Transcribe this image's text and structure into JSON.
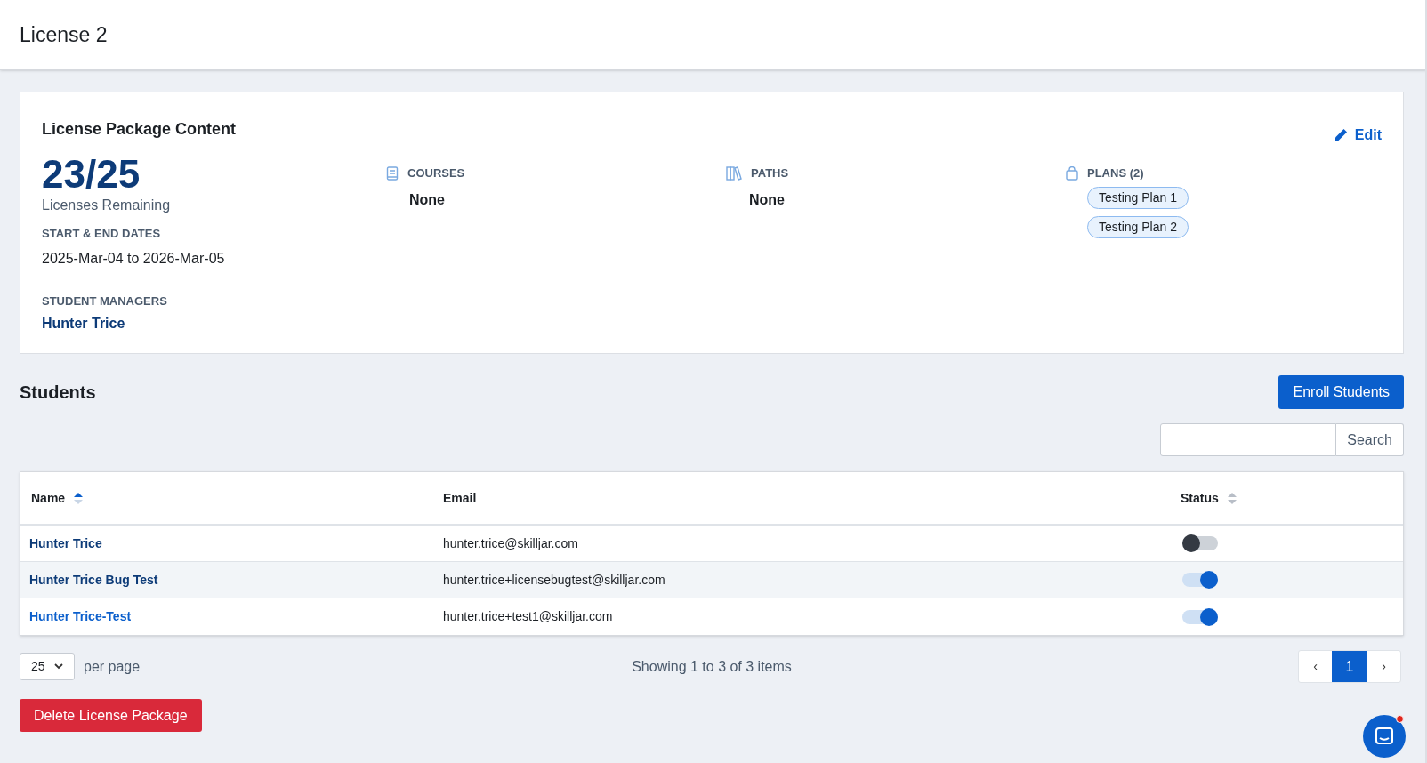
{
  "header": {
    "title": "License 2"
  },
  "package": {
    "title": "License Package Content",
    "edit_label": "Edit",
    "remaining": "23/25",
    "remaining_label": "Licenses Remaining",
    "dates_label": "START & END DATES",
    "dates": "2025-Mar-04 to 2026-Mar-05",
    "managers_label": "STUDENT MANAGERS",
    "managers": [
      "Hunter Trice"
    ],
    "sections": [
      {
        "kind": "courses",
        "label": "COURSES",
        "value": "None"
      },
      {
        "kind": "paths",
        "label": "PATHS",
        "value": "None"
      },
      {
        "kind": "plans",
        "label": "PLANS (2)",
        "tags": [
          "Testing Plan 1",
          "Testing Plan 2"
        ]
      }
    ]
  },
  "students": {
    "title": "Students",
    "enroll_label": "Enroll Students",
    "search_button": "Search",
    "columns": [
      {
        "label": "Name",
        "sortable": true,
        "sorted": true
      },
      {
        "label": "Email",
        "sortable": false
      },
      {
        "label": "Status",
        "sortable": true,
        "sorted": false
      }
    ],
    "rows": [
      {
        "name": "Hunter Trice",
        "visited": true,
        "email": "hunter.trice@skilljar.com",
        "on": false
      },
      {
        "name": "Hunter Trice Bug Test",
        "visited": true,
        "email": "hunter.trice+licensebugtest@skilljar.com",
        "on": true
      },
      {
        "name": "Hunter Trice-Test",
        "visited": false,
        "email": "hunter.trice+test1@skilljar.com",
        "on": true
      }
    ],
    "per_page": "25",
    "per_page_label": "per page",
    "showing": "Showing 1 to 3 of 3 items",
    "pagination": {
      "prev": "‹",
      "pages": [
        {
          "label": "1",
          "selected": true
        }
      ],
      "next": "›"
    }
  },
  "delete_label": "Delete License Package",
  "chat": {
    "unread": true
  }
}
